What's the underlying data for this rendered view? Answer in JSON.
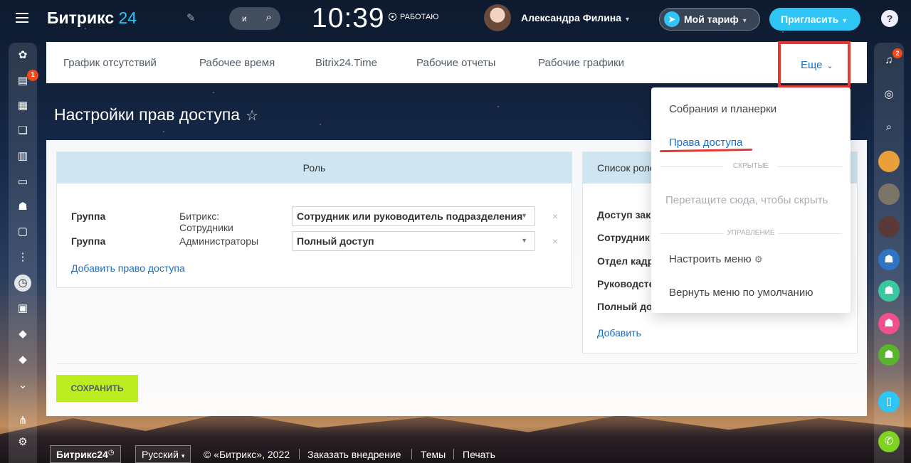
{
  "header": {
    "logo_text": "Битрикс",
    "logo_num": "24",
    "search_text": "и",
    "clock": "10:39",
    "status": "РАБОТАЮ",
    "user_name": "Александра Филина",
    "tariff_label": "Мой тариф",
    "invite_label": "Пригласить",
    "help_label": "?"
  },
  "left_sidebar": {
    "badge": "1"
  },
  "right_sidebar": {
    "badge": "2"
  },
  "nav": {
    "items": [
      "График отсутствий",
      "Рабочее время",
      "Bitrix24.Time",
      "Рабочие отчеты",
      "Рабочие графики"
    ],
    "more_label": "Еще"
  },
  "page": {
    "title": "Настройки прав доступа"
  },
  "roles": {
    "header": "Роль",
    "rows": [
      {
        "label": "Группа",
        "group": "Битрикс: Сотрудники",
        "value": "Сотрудник или руководитель подразделения"
      },
      {
        "label": "Группа",
        "group": "Администраторы",
        "value": "Полный доступ"
      }
    ],
    "add_link": "Добавить право доступа"
  },
  "role_list": {
    "header": "Список роле",
    "items": [
      "Доступ закр",
      "Сотрудник",
      "Отдел кадр",
      "Руководсте",
      "Полный до"
    ],
    "add_link": "Добавить"
  },
  "save_label": "СОХРАНИТЬ",
  "menu": {
    "item1": "Собрания и планерки",
    "item2": "Права доступа",
    "sep_hidden": "СКРЫТЫЕ",
    "hint": "Перетащите сюда, чтобы скрыть",
    "sep_manage": "УПРАВЛЕНИЕ",
    "configure": "Настроить меню",
    "reset": "Вернуть меню по умолчанию"
  },
  "footer": {
    "brand": "Битрикс24",
    "lang": "Русский",
    "copyright": "© «Битрикс», 2022",
    "order": "Заказать внедрение",
    "themes": "Темы",
    "print": "Печать"
  },
  "colors": {
    "accent": "#2fc6f6",
    "link": "#1a6ec5",
    "save": "#bbed21",
    "highlight": "#e53935"
  }
}
